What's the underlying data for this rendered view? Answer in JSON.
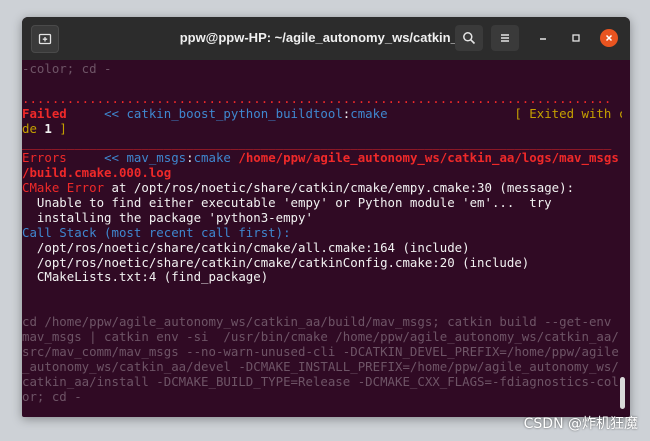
{
  "window": {
    "title": "ppw@ppw-HP: ~/agile_autonomy_ws/catkin_aa"
  },
  "icons": {
    "new_tab": "new-tab-icon",
    "search": "search-icon",
    "menu": "hamburger-menu-icon",
    "minimize": "minimize-icon",
    "maximize": "maximize-icon",
    "close": "close-icon"
  },
  "colors": {
    "terminal_bg": "#300a24",
    "error_red": "#ef2929",
    "info_blue": "#3f87cf",
    "warn_yellow": "#c4a000",
    "close_orange": "#e95420"
  },
  "terminal": {
    "l01": "-color; cd -",
    "l02": "",
    "l03": "...............................................................................",
    "l04_a": "Failed",
    "l04_b": "     << catkin_boost_python_buildtool",
    "l04_c": ":",
    "l04_d": "cmake",
    "l04_e": "                 [ Exited with co",
    "l05_a": "de ",
    "l05_b": "1",
    "l05_c": " ]",
    "l06": "_______________________________________________________________________________",
    "l07_a": "Errors",
    "l07_b": "     << mav_msgs",
    "l07_c": ":",
    "l07_d": "cmake",
    "l07_e": " /home/ppw/agile_autonomy_ws/catkin_aa/logs/mav_msgs",
    "l08": "/build.cmake.000.log",
    "l09_a": "CMake Error",
    "l09_b": " at /opt/ros/noetic/share/catkin/cmake/empy.cmake:30 (message):",
    "l10": "  Unable to find either executable 'empy' or Python module 'em'...  try",
    "l11": "  installing the package 'python3-empy'",
    "l12": "Call Stack (most recent call first):",
    "l13": "  /opt/ros/noetic/share/catkin/cmake/all.cmake:164 (include)",
    "l14": "  /opt/ros/noetic/share/catkin/cmake/catkinConfig.cmake:20 (include)",
    "l15": "  CMakeLists.txt:4 (find_package)",
    "l16": "",
    "l17": "",
    "l18": "cd /home/ppw/agile_autonomy_ws/catkin_aa/build/mav_msgs; catkin build --get-env",
    "l19": "mav_msgs | catkin env -si  /usr/bin/cmake /home/ppw/agile_autonomy_ws/catkin_aa/",
    "l20": "src/mav_comm/mav_msgs --no-warn-unused-cli -DCATKIN_DEVEL_PREFIX=/home/ppw/agile",
    "l21": "_autonomy_ws/catkin_aa/devel -DCMAKE_INSTALL_PREFIX=/home/ppw/agile_autonomy_ws/",
    "l22": "catkin_aa/install -DCMAKE_BUILD_TYPE=Release -DCMAKE_CXX_FLAGS=-fdiagnostics-col",
    "l23": "or; cd -"
  },
  "watermark": "CSDN @炸机狂魔"
}
